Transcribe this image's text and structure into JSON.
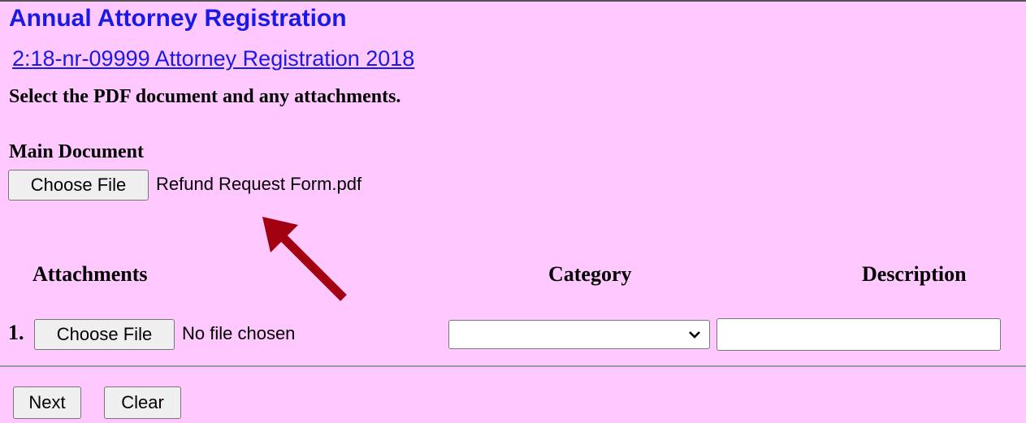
{
  "page": {
    "title": "Annual Attorney Registration",
    "case_link": "2:18-nr-09999 Attorney Registration 2018",
    "instruction": "Select the PDF document and any attachments."
  },
  "main_document": {
    "label": "Main Document",
    "choose_button": "Choose File",
    "file_name": "Refund Request Form.pdf"
  },
  "annotation": {
    "arrow_color": "#a00010"
  },
  "attachments": {
    "headers": {
      "attachments": "Attachments",
      "category": "Category",
      "description": "Description"
    },
    "rows": [
      {
        "number": "1.",
        "choose_button": "Choose File",
        "file_status": "No file chosen",
        "category_selected": "",
        "description_value": ""
      }
    ]
  },
  "actions": {
    "next": "Next",
    "clear": "Clear"
  },
  "colors": {
    "background": "#ffc8ff",
    "link": "#1a1ae6"
  }
}
